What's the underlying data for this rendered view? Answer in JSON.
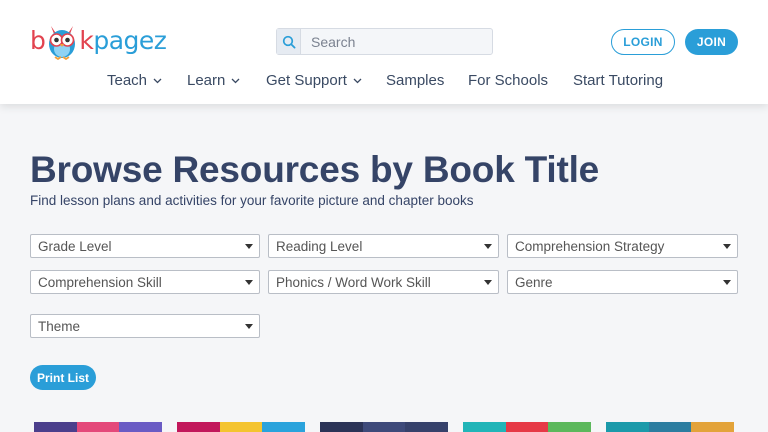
{
  "header": {
    "logo": {
      "part1": "b",
      "part2": "k",
      "part3": "pagez"
    },
    "search": {
      "placeholder": "Search"
    },
    "login_label": "LOGIN",
    "join_label": "JOIN"
  },
  "nav": [
    {
      "label": "Teach",
      "dropdown": true
    },
    {
      "label": "Learn",
      "dropdown": true
    },
    {
      "label": "Get Support",
      "dropdown": true
    },
    {
      "label": "Samples",
      "dropdown": false
    },
    {
      "label": "For Schools",
      "dropdown": false
    },
    {
      "label": "Start Tutoring",
      "dropdown": false
    }
  ],
  "page": {
    "title": "Browse Resources by Book Title",
    "subtitle": "Find lesson plans and activities for your favorite picture and chapter books"
  },
  "filters": [
    "Grade Level",
    "Reading Level",
    "Comprehension Strategy",
    "Comprehension Skill",
    "Phonics / Word Work Skill",
    "Genre",
    "Theme"
  ],
  "print_label": "Print List",
  "colors": {
    "brand_blue": "#2a9ed8",
    "brand_red": "#e2434f",
    "heading": "#354467"
  },
  "thumbnails": [
    [
      "#4b3f8c",
      "#e4497a",
      "#6a5bc4"
    ],
    [
      "#c2185b",
      "#f4c430",
      "#2aa3dc"
    ],
    [
      "#2b3357",
      "#3e4a7a",
      "#36416b"
    ],
    [
      "#21b5b8",
      "#e63946",
      "#5cb85c"
    ],
    [
      "#1b9aaa",
      "#2c7da0",
      "#e3a33a"
    ]
  ]
}
